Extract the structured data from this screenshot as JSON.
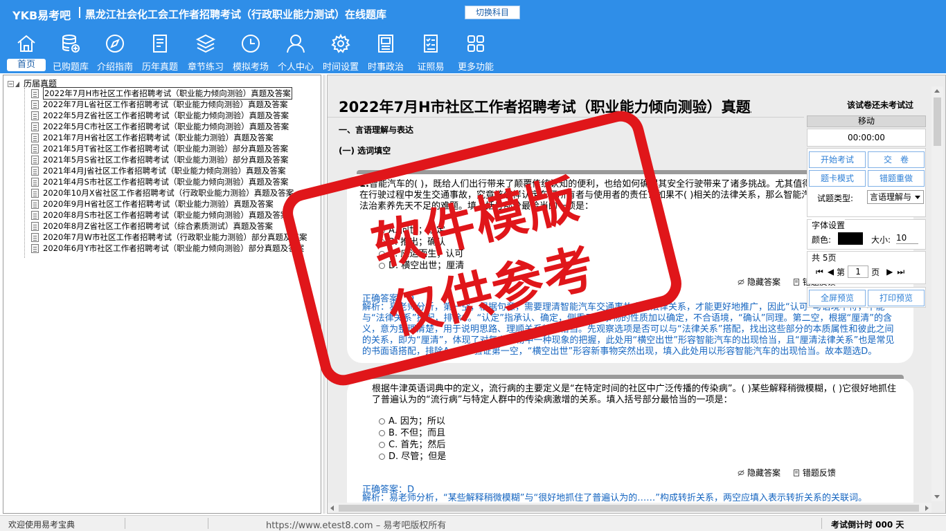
{
  "header": {
    "brand": "YKB易考吧",
    "title": "黑龙江社会化工会工作者招聘考试（行政职业能力测试）在线题库",
    "switch_label": "切换科目"
  },
  "toolbar": [
    {
      "label": "首页",
      "icon": "home-icon"
    },
    {
      "label": "已购题库",
      "icon": "database-icon"
    },
    {
      "label": "介绍指南",
      "icon": "compass-icon"
    },
    {
      "label": "历年真题",
      "icon": "document-icon"
    },
    {
      "label": "章节练习",
      "icon": "layers-icon"
    },
    {
      "label": "模拟考场",
      "icon": "clock-icon"
    },
    {
      "label": "个人中心",
      "icon": "user-icon"
    },
    {
      "label": "时间设置",
      "icon": "gear-icon"
    },
    {
      "label": "时事政治",
      "icon": "newspaper-icon"
    },
    {
      "label": "证照易",
      "icon": "checklist-icon"
    },
    {
      "label": "更多功能",
      "icon": "grid-icon"
    }
  ],
  "tree": {
    "root": "历届真题",
    "items": [
      "2022年7月H市社区工作者招聘考试（职业能力倾向测验）真题及答案",
      "2022年7月L省社区工作者招聘考试（职业能力倾向测验）真题及答案",
      "2022年5月Z省社区工作者招聘考试（职业能力倾向测验）真题及答案",
      "2022年5月C市社区工作者招聘考试（职业能力倾向测验）真题及答案",
      "2021年7月H省社区工作者招聘考试（职业能力测验）真题及答案",
      "2021年5月T省社区工作者招聘考试（职业能力测验）部分真题及答案",
      "2021年5月S省社区工作者招聘考试（职业能力测验）部分真题及答案",
      "2021年4月J省社区工作者招聘考试（职业能力倾向测验）真题及答案",
      "2021年4月S市社区工作者招聘考试（职业能力倾向测验）真题及答案",
      "2020年10月X省社区工作者招聘考试（行政职业能力测验）真题及答案",
      "2020年9月H省社区工作者招聘考试（职业能力测验）真题及答案",
      "2020年8月S市社区工作者招聘考试（职业能力倾向测验）真题及答案",
      "2020年8月Z省社区工作者招聘考试（综合素质测试）真题及答案",
      "2020年7月W市社区工作者招聘考试（行政职业能力测验）部分真题及答案",
      "2020年6月Y市社区工作者招聘考试（职业能力倾向测验）部分真题及答案"
    ]
  },
  "exam": {
    "title": "2022年7月H市社区工作者招聘考试（职业能力倾向测验）真题及答案",
    "status": "该试卷还未考试过",
    "section": "一、言语理解与表达",
    "subsection": "(一) 选词填空",
    "q1": {
      "number": "1.",
      "text": "智能汽车的( )，既给人们出行带来了颠覆传统认知的便利，也给如何确保其安全行驶带来了诸多挑战。尤其值得关注的是，智能汽车在行驶过程中发生交通事故，究竟该怎样认定车辆所有者与使用者的责任？如果不( )相关的法律关系，那么智能汽车的推广必然会面临法治素养先天不足的难题。填入括号部分最恰当的一项是：",
      "options": [
        "A. 问世；认定",
        "B. 推出；确认",
        "C. 应运而生；认可",
        "D. 横空出世；厘清"
      ],
      "hide_answer": "隐藏答案",
      "feedback": "错题反馈",
      "answer": "正确答案：D",
      "analysis": "解析：易老师分析，第一空，根据句意，需要理清智能汽车交通事故中的法律关系，才能更好地推广，因此“认可”与语境不符，不能与“法律关系”搭配，排除C。“认定”指承认、确定，侧重于对事物的性质加以确定，不合语境，“确认”同理。第二空，根据“厘清”的含义，意为整理清楚，用于说明思路、理顺关系较为恰当。先观察选项是否可以与“法律关系”搭配，找出这些部分的本质属性和彼此之间的关系，即为“厘清”，体现了对复杂事物中一种现象的把握，此处用“横空出世”形容智能汽车的出现恰当，且“厘清法律关系”也是常见的书面语搭配，排除A、B。验证第一空，“横空出世”形容新事物突然出现，填入此处用以形容智能汽车的出现恰当。故本题选D。"
    },
    "q2": {
      "text": "根据牛津英语词典中的定义，流行病的主要定义是“在特定时间的社区中广泛传播的传染病”。( )某些解释稍微模糊，( )它很好地抓住了普遍认为的“流行病”与特定人群中的传染病激增的关系。填入括号部分最恰当的一项是：",
      "options": [
        "A. 因为；所以",
        "B. 不但；而且",
        "C. 首先；然后",
        "D. 尽管；但是"
      ],
      "hide_answer": "隐藏答案",
      "feedback": "错题反馈",
      "answer": "正确答案：D",
      "analysis": "解析：易老师分析，“某些解释稍微模糊”与“很好地抓住了普遍认为的……”构成转折关系，两空应填入表示转折关系的关联词。"
    }
  },
  "side_panel": {
    "move": "移动",
    "timer": "00:00:00",
    "start_exam": "开始考试",
    "submit": "交　卷",
    "card_mode": "题卡模式",
    "retry_wrong": "错题重做",
    "type_label": "试题类型:",
    "type_value": "言语理解与",
    "font_title": "字体设置",
    "color_label": "颜色:",
    "size_label": "大小:",
    "font_size": "10",
    "pages_total": "共 5页",
    "page_prefix": "第",
    "page_value": "1",
    "page_suffix": "页",
    "fullscreen": "全屏预览",
    "print": "打印预览",
    "font_color": "#000000"
  },
  "status": {
    "welcome": "欢迎使用易考宝典",
    "url": "https://www.etest8.com – 易考吧版权所有",
    "countdown": "考试倒计时 000 天"
  },
  "watermark": {
    "line1": "软件模版",
    "line2": "仅供参考",
    "color": "#e0161a"
  },
  "colors": {
    "header_bg": "#2f8ee8",
    "answer_text": "#1565c0"
  }
}
